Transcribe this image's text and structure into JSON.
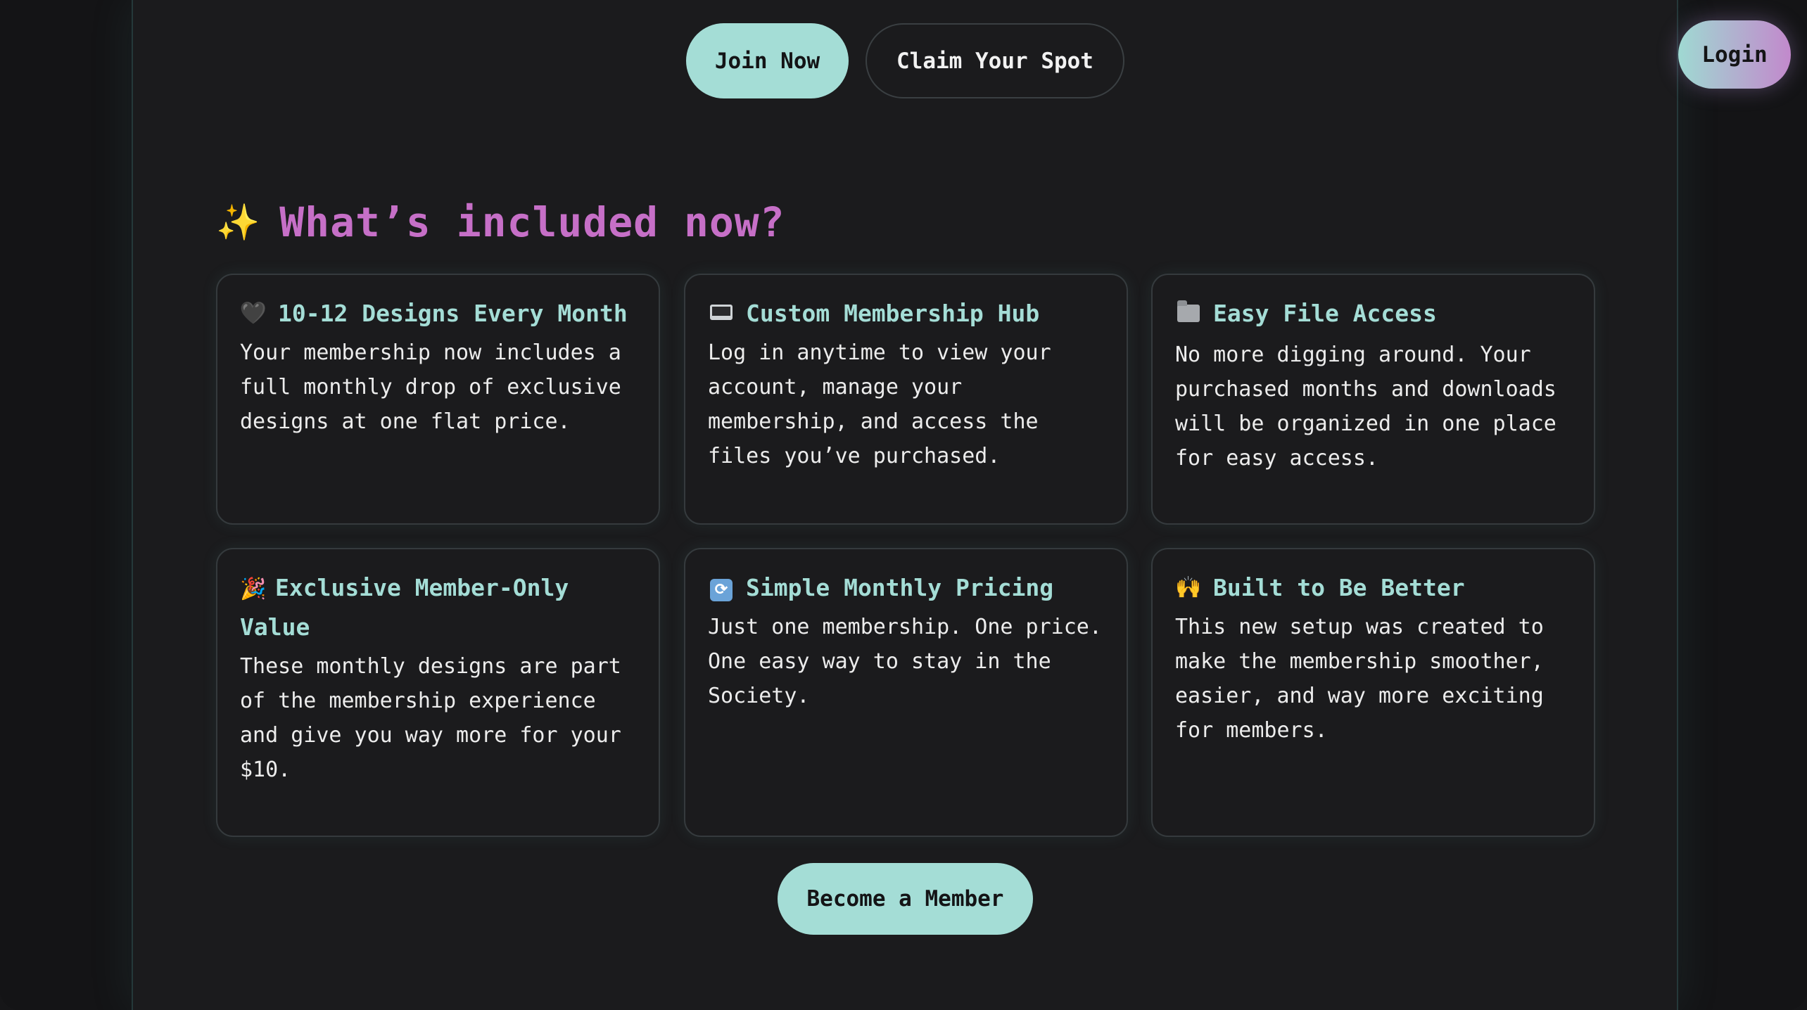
{
  "nav": {
    "join_label": "Join Now",
    "claim_label": "Claim Your Spot",
    "login_label": "Login"
  },
  "section": {
    "heading_icon": "✨",
    "heading": "What’s included now?"
  },
  "features": [
    {
      "icon": "🖤",
      "icon_name": "black-heart-icon",
      "title": "10-12 Designs Every Month",
      "body": "Your membership now includes a full monthly drop of exclusive designs at one flat price."
    },
    {
      "icon": "💻",
      "icon_name": "laptop-icon",
      "title": "Custom Membership Hub",
      "body": "Log in anytime to view your account, manage your membership, and access the files you’ve purchased."
    },
    {
      "icon": "📁",
      "icon_name": "folder-icon",
      "title": "Easy File Access",
      "body": "No more digging around. Your purchased months and downloads will be organized in one place for easy access."
    },
    {
      "icon": "🎉",
      "icon_name": "party-popper-icon",
      "title": "Exclusive Member-Only Value",
      "body": "These monthly designs are part of the membership experience and give you way more for your $10."
    },
    {
      "icon": "🔁",
      "icon_name": "repeat-icon",
      "title": "Simple Monthly Pricing",
      "body": "Just one membership. One price. One easy way to stay in the Society."
    },
    {
      "icon": "🙌",
      "icon_name": "raised-hands-icon",
      "title": "Built to Be Better",
      "body": "This new setup was created to make the membership smoother, easier, and way more exciting for members."
    }
  ],
  "cta": {
    "become_member_label": "Become a Member"
  },
  "colors": {
    "background": "#1b1b1d",
    "accent_teal": "#a4ddd6",
    "heading_pink": "#c66fc7",
    "login_gradient_start": "#9fd9d2",
    "login_gradient_end": "#c289cc"
  }
}
